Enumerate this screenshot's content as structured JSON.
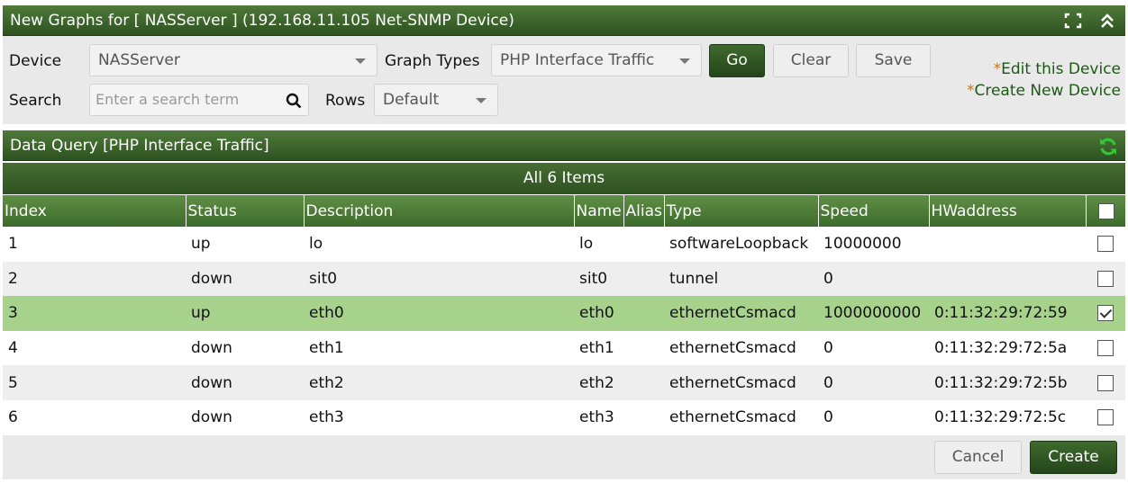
{
  "header": {
    "title": "New Graphs for [ NASServer ] (192.168.11.105 Net-SNMP Device)",
    "icons": [
      "fullscreen-icon",
      "collapse-up-icon"
    ]
  },
  "filter": {
    "device_label": "Device",
    "device_value": "NASServer",
    "graph_types_label": "Graph Types",
    "graph_types_value": "PHP Interface Traffic",
    "go_label": "Go",
    "clear_label": "Clear",
    "save_label": "Save",
    "search_label": "Search",
    "search_placeholder": "Enter a search term",
    "rows_label": "Rows",
    "rows_value": "Default",
    "star": "*",
    "edit_device_link": "Edit this Device",
    "create_device_link": "Create New Device"
  },
  "data_query": {
    "title": "Data Query [PHP Interface Traffic]",
    "items_label": "All 6 Items"
  },
  "table": {
    "columns": [
      "Index",
      "Status",
      "Description",
      "Name",
      "Alias",
      "Type",
      "Speed",
      "HWaddress"
    ],
    "rows": [
      {
        "index": "1",
        "status": "up",
        "description": "lo",
        "name": "lo",
        "alias": "",
        "type": "softwareLoopback",
        "speed": "10000000",
        "hwaddress": ""
      },
      {
        "index": "2",
        "status": "down",
        "description": "sit0",
        "name": "sit0",
        "alias": "",
        "type": "tunnel",
        "speed": "0",
        "hwaddress": ""
      },
      {
        "index": "3",
        "status": "up",
        "description": "eth0",
        "name": "eth0",
        "alias": "",
        "type": "ethernetCsmacd",
        "speed": "1000000000",
        "hwaddress": "0:11:32:29:72:59"
      },
      {
        "index": "4",
        "status": "down",
        "description": "eth1",
        "name": "eth1",
        "alias": "",
        "type": "ethernetCsmacd",
        "speed": "0",
        "hwaddress": "0:11:32:29:72:5a"
      },
      {
        "index": "5",
        "status": "down",
        "description": "eth2",
        "name": "eth2",
        "alias": "",
        "type": "ethernetCsmacd",
        "speed": "0",
        "hwaddress": "0:11:32:29:72:5b"
      },
      {
        "index": "6",
        "status": "down",
        "description": "eth3",
        "name": "eth3",
        "alias": "",
        "type": "ethernetCsmacd",
        "speed": "0",
        "hwaddress": "0:11:32:29:72:5c"
      }
    ]
  },
  "footer": {
    "cancel_label": "Cancel",
    "create_label": "Create"
  },
  "colors": {
    "header_green": "#2d5220",
    "selected_row": "#a7d28c",
    "link_green": "#1c5a14",
    "asterisk": "#c77a16",
    "refresh_icon": "#32c832"
  }
}
